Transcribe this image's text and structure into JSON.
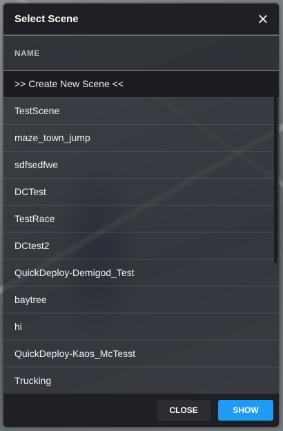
{
  "dialog": {
    "title": "Select Scene",
    "close_icon": "close-icon"
  },
  "table": {
    "column_header": "NAME",
    "items": [
      {
        "label": ">> Create New Scene <<",
        "selected": true
      },
      {
        "label": "TestScene"
      },
      {
        "label": "maze_town_jump"
      },
      {
        "label": "sdfsedfwe"
      },
      {
        "label": "DCTest"
      },
      {
        "label": "TestRace"
      },
      {
        "label": "DCtest2"
      },
      {
        "label": "QuickDeploy-Demigod_Test"
      },
      {
        "label": "baytree"
      },
      {
        "label": "hi"
      },
      {
        "label": "QuickDeploy-Kaos_McTesst"
      },
      {
        "label": "Trucking"
      }
    ]
  },
  "footer": {
    "close_label": "CLOSE",
    "show_label": "SHOW"
  },
  "colors": {
    "accent": "#1f9bf2",
    "header_bg": "#1e2025",
    "selected_row_bg": "#1a1c21"
  }
}
